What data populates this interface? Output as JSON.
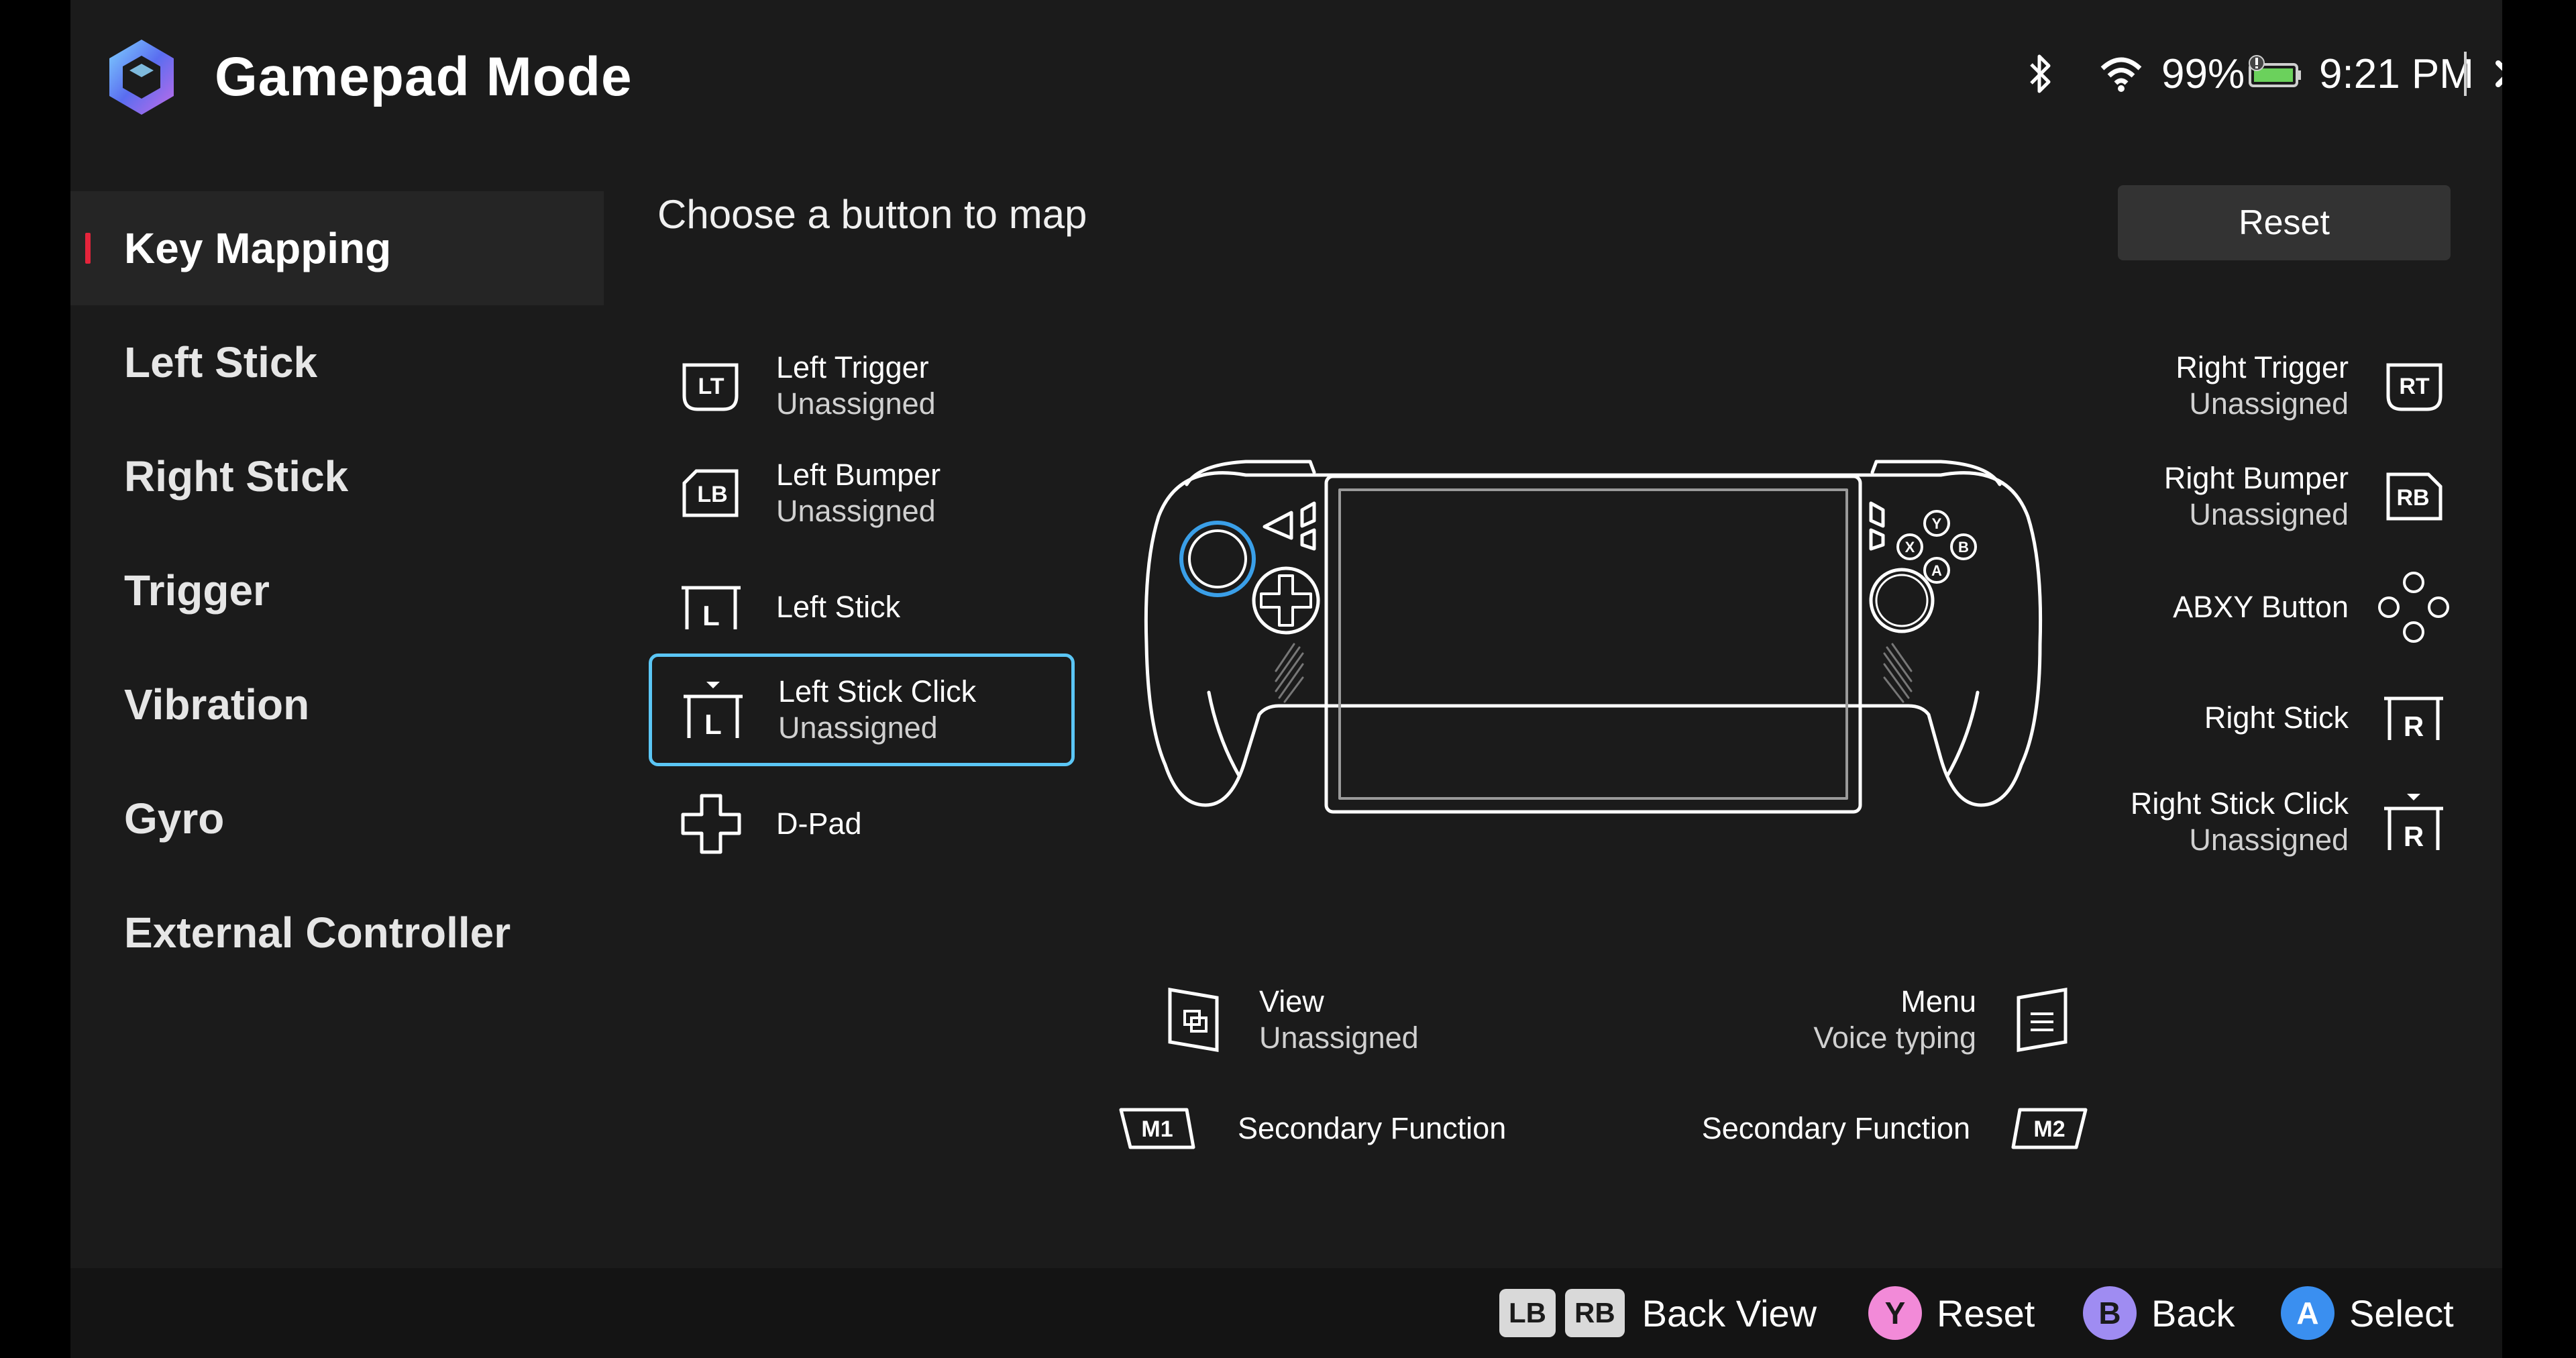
{
  "header": {
    "title": "Gamepad Mode",
    "status": {
      "battery_percent": "99%",
      "time": "9:21 PM"
    }
  },
  "sidebar": {
    "items": [
      {
        "label": "Key Mapping",
        "active": true
      },
      {
        "label": "Left Stick"
      },
      {
        "label": "Right Stick"
      },
      {
        "label": "Trigger"
      },
      {
        "label": "Vibration"
      },
      {
        "label": "Gyro"
      },
      {
        "label": "External Controller"
      }
    ]
  },
  "main": {
    "prompt": "Choose a button to map",
    "reset_label": "Reset",
    "left_mappings": [
      {
        "name": "Left Trigger",
        "value": "Unassigned",
        "icon": "lt-icon",
        "icon_text": "LT"
      },
      {
        "name": "Left Bumper",
        "value": "Unassigned",
        "icon": "lb-icon",
        "icon_text": "LB"
      },
      {
        "name": "Left Stick",
        "value": "",
        "icon": "left-stick-icon",
        "icon_text": "L"
      },
      {
        "name": "Left Stick Click",
        "value": "Unassigned",
        "icon": "left-stick-click-icon",
        "icon_text": "L",
        "selected": true
      },
      {
        "name": "D-Pad",
        "value": "",
        "icon": "dpad-icon"
      }
    ],
    "right_mappings": [
      {
        "name": "Right Trigger",
        "value": "Unassigned",
        "icon": "rt-icon",
        "icon_text": "RT"
      },
      {
        "name": "Right Bumper",
        "value": "Unassigned",
        "icon": "rb-icon",
        "icon_text": "RB"
      },
      {
        "name": "ABXY Button",
        "value": "",
        "icon": "abxy-icon"
      },
      {
        "name": "Right Stick",
        "value": "",
        "icon": "right-stick-icon",
        "icon_text": "R"
      },
      {
        "name": "Right Stick Click",
        "value": "Unassigned",
        "icon": "right-stick-click-icon",
        "icon_text": "R"
      }
    ],
    "bottom_mappings": [
      {
        "name": "View",
        "value": "Unassigned",
        "icon": "view-icon"
      },
      {
        "name": "Menu",
        "value": "Voice typing",
        "icon": "menu-icon"
      },
      {
        "name": "Secondary Function",
        "value": "",
        "icon": "m1-icon",
        "icon_text": "M1"
      },
      {
        "name": "Secondary Function",
        "value": "",
        "icon": "m2-icon",
        "icon_text": "M2"
      }
    ],
    "device_buttons": {
      "y": "Y",
      "b": "B",
      "x": "X",
      "a": "A"
    }
  },
  "footer": {
    "hints": [
      {
        "keys": [
          "LB",
          "RB"
        ],
        "label": "Back View"
      },
      {
        "key": "Y",
        "label": "Reset",
        "color": "#f28ad8"
      },
      {
        "key": "B",
        "label": "Back",
        "color": "#9f8cf2"
      },
      {
        "key": "A",
        "label": "Select",
        "color": "#3a8ff0"
      }
    ]
  },
  "colors": {
    "accent_selected": "#5bc6f5",
    "active_indicator": "#e5243b",
    "left_stick_highlight": "#3a9fe8"
  }
}
